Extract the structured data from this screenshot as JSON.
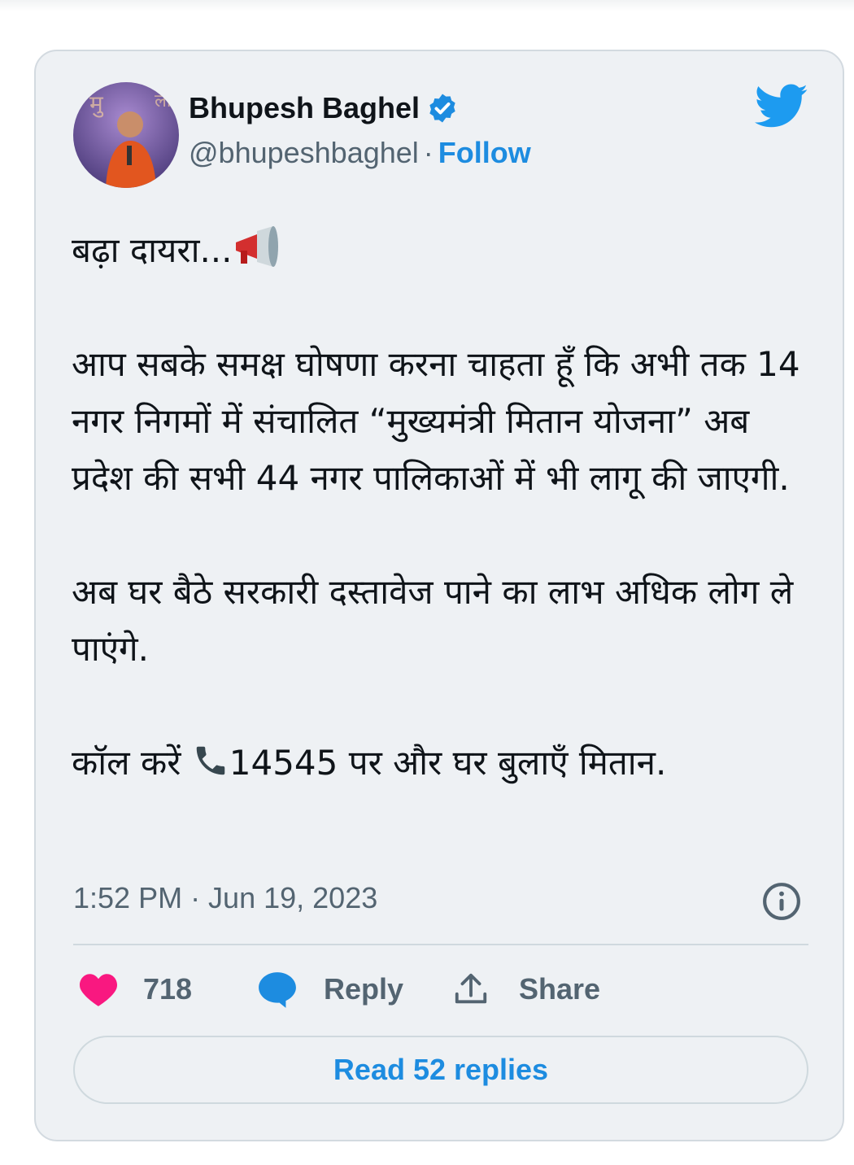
{
  "author": {
    "name": "Bhupesh Baghel",
    "handle": "@bhupeshbaghel",
    "separator": "·",
    "follow_label": "Follow",
    "verified": true
  },
  "icons": {
    "brand": "twitter-bird-icon",
    "verified": "verified-badge-icon",
    "info": "info-icon",
    "like": "heart-icon",
    "reply": "speech-bubble-icon",
    "share": "share-upload-icon",
    "megaphone": "megaphone-icon",
    "phone": "telephone-icon"
  },
  "tweet": {
    "line1": "बढ़ा दायरा...",
    "para2": "आप सबके समक्ष घोषणा करना चाहता हूँ कि अभी तक 14 नगर निगमों में संचालित “मुख्यमंत्री मितान योजना” अब प्रदेश की सभी 44 नगर पालिकाओं में भी लागू की जाएगी.",
    "para3": "अब घर बैठे सरकारी दस्तावेज पाने का लाभ अधिक लोग ले पाएंगे.",
    "para4_before": "कॉल करें ",
    "para4_after": "14545 पर और घर बुलाएँ मितान."
  },
  "timestamp": "1:52 PM · Jun 19, 2023",
  "actions": {
    "likes": "718",
    "reply_label": "Reply",
    "share_label": "Share"
  },
  "read_replies_label": "Read 52 replies",
  "colors": {
    "accent": "#1d8ce0",
    "like": "#f91880",
    "card_bg": "#eef1f4",
    "text": "#0f1419",
    "muted": "#536471"
  }
}
